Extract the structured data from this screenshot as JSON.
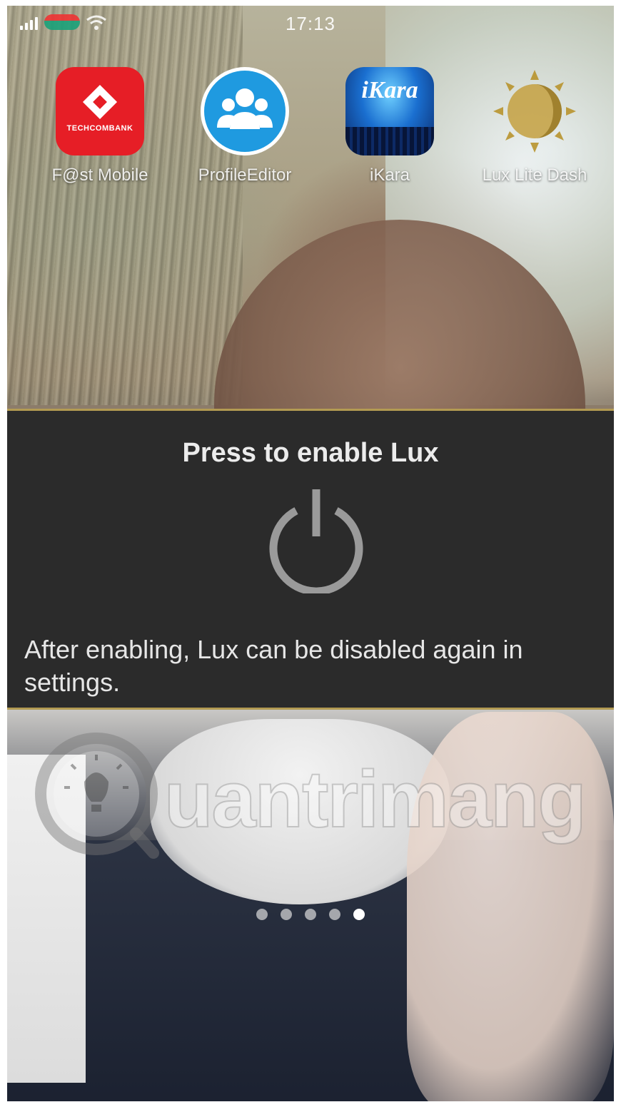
{
  "status_bar": {
    "time": "17:13",
    "signal_icon": "signal-bars-icon",
    "carrier_icon": "carrier-logo-icon",
    "wifi_icon": "wifi-icon"
  },
  "apps": [
    {
      "label": "F@st Mobile",
      "icon": "techcombank-icon",
      "icon_text": "TECHCOMBANK"
    },
    {
      "label": "ProfileEditor",
      "icon": "profile-editor-icon"
    },
    {
      "label": "iKara",
      "icon": "ikara-icon",
      "icon_text": "iKara"
    },
    {
      "label": "Lux Lite Dash",
      "icon": "sun-icon"
    }
  ],
  "lux_dialog": {
    "title": "Press to enable Lux",
    "power_icon": "power-icon",
    "note": "After enabling, Lux can be disabled again in settings."
  },
  "watermark": {
    "text": "uantrimang",
    "icon": "lightbulb-logo-icon"
  },
  "page_indicator": {
    "count": 5,
    "active_index": 4
  },
  "colors": {
    "panel_bg": "#2b2b2b",
    "panel_border": "#b39b52",
    "techcombank_red": "#e61e26",
    "profile_blue": "#1f9ae0"
  }
}
